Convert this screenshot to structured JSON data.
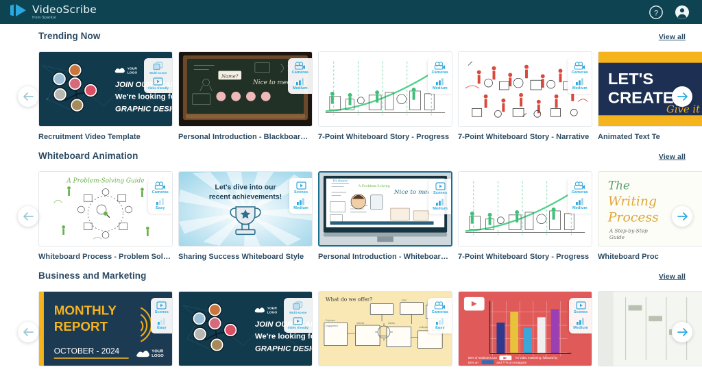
{
  "header": {
    "logo_text": "VideoScribe",
    "logo_subtitle": "from Sparkol",
    "help_icon": "help-circle-icon",
    "account_icon": "account-circle-icon"
  },
  "nav": {
    "prev_label": "arrow-left-icon",
    "next_label": "arrow-right-icon"
  },
  "common": {
    "view_all_label": "View all"
  },
  "sections": [
    {
      "id": "trending-now",
      "title": "Trending Now",
      "view_all_label": "View all",
      "cards": [
        {
          "title": "Recruitment Video Template",
          "badges": [
            {
              "icon": "multi-scene-icon",
              "label": "Multi-scene"
            },
            {
              "icon": "video-friendly-icon",
              "label": "Video friendly"
            }
          ],
          "selected": false
        },
        {
          "title": "Personal Introduction - Blackboard S...",
          "badges": [
            {
              "icon": "camera-icon",
              "label": "Cameras"
            },
            {
              "icon": "bars-icon",
              "label": "Medium"
            }
          ],
          "selected": false
        },
        {
          "title": "7-Point Whiteboard Story - Progress",
          "badges": [
            {
              "icon": "camera-icon",
              "label": "Cameras"
            },
            {
              "icon": "bars-icon",
              "label": "Medium"
            }
          ],
          "selected": false
        },
        {
          "title": "7-Point Whiteboard Story - Narrative",
          "badges": [
            {
              "icon": "camera-icon",
              "label": "Cameras"
            },
            {
              "icon": "bars-icon",
              "label": "Medium"
            }
          ],
          "selected": false
        },
        {
          "title": "Animated Text Te",
          "badges": [],
          "selected": false
        }
      ]
    },
    {
      "id": "whiteboard-animation",
      "title": "Whiteboard Animation",
      "view_all_label": "View all",
      "cards": [
        {
          "title": "Whiteboard Process - Problem Solving",
          "badges": [
            {
              "icon": "camera-icon",
              "label": "Cameras"
            },
            {
              "icon": "bars-icon",
              "label": "Easy"
            }
          ],
          "selected": false
        },
        {
          "title": "Sharing Success Whiteboard Style",
          "badges": [
            {
              "icon": "scenes-icon",
              "label": "Scenes"
            },
            {
              "icon": "bars-icon",
              "label": "Medium"
            }
          ],
          "selected": false
        },
        {
          "title": "Personal Introduction - Whiteboard ...",
          "badges": [
            {
              "icon": "scenes-icon",
              "label": "Scenes"
            },
            {
              "icon": "bars-icon",
              "label": "Medium"
            }
          ],
          "selected": true
        },
        {
          "title": "7-Point Whiteboard Story - Progress",
          "badges": [
            {
              "icon": "camera-icon",
              "label": "Cameras"
            },
            {
              "icon": "bars-icon",
              "label": "Medium"
            }
          ],
          "selected": false
        },
        {
          "title": "Whiteboard Proc",
          "badges": [],
          "selected": false
        }
      ]
    },
    {
      "id": "business-and-marketing",
      "title": "Business and Marketing",
      "view_all_label": "View all",
      "cards": [
        {
          "title": "",
          "badges": [
            {
              "icon": "scenes-icon",
              "label": "Scenes"
            },
            {
              "icon": "bars-icon",
              "label": "Easy"
            }
          ],
          "selected": false
        },
        {
          "title": "",
          "badges": [
            {
              "icon": "multi-scene-icon",
              "label": "Multi-scene"
            },
            {
              "icon": "video-friendly-icon",
              "label": "Video friendly"
            }
          ],
          "selected": false
        },
        {
          "title": "",
          "badges": [
            {
              "icon": "camera-icon",
              "label": "Cameras"
            },
            {
              "icon": "bars-icon",
              "label": "Easy"
            }
          ],
          "selected": false
        },
        {
          "title": "",
          "badges": [
            {
              "icon": "scenes-icon",
              "label": "Scenes"
            },
            {
              "icon": "bars-icon",
              "label": "Medium"
            }
          ],
          "selected": false
        },
        {
          "title": "",
          "badges": [],
          "selected": false
        }
      ]
    }
  ],
  "artwork": {
    "recruitment": {
      "logo_label_1": "YOUR",
      "logo_label_2": "LOGO",
      "line1": "JOIN OUR TEAM",
      "line2": "We're looking for",
      "line3": "GRAPHIC DESIGNER"
    },
    "blackboard": {
      "name_label": "Name?",
      "greeting": "Nice to meet you"
    },
    "problem_solving": {
      "title": "A Problem-Solving Guide"
    },
    "sharing_success": {
      "line1": "Let's dive into our",
      "line2": "recent achievements!"
    },
    "whiteboard_intro": {
      "greeting": "Nice to meet you"
    },
    "writing_process": {
      "line1": "The",
      "line2": "Writing",
      "line3": "Process",
      "sub": "A Step-by-Step Guide"
    },
    "monthly_report": {
      "line1": "MONTHLY",
      "line2": "REPORT",
      "date": "OCTOBER - 2024",
      "logo_1": "YOUR",
      "logo_2": "LOGO"
    },
    "what_do_we_offer": {
      "title": "What do we offer?"
    },
    "marketing_stats": {
      "stat_line": "89% of marketers use YouTube for video marketing, followed by 64% on LinkedIn and 77% on Instagram"
    }
  },
  "colors": {
    "header_bg": "#0e4352",
    "accent_blue": "#2aa9e0",
    "title_text": "#2c4b63",
    "navy": "#1d3a53",
    "gold": "#f5b31c"
  }
}
